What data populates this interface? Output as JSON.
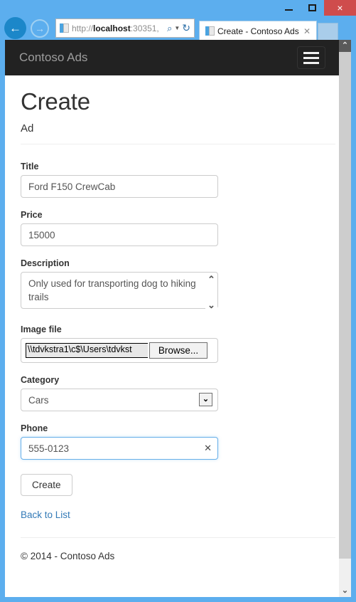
{
  "browser": {
    "window_controls": {
      "minimize": "minimize-icon",
      "maximize": "maximize-icon",
      "close": "×"
    },
    "nav": {
      "back": "←",
      "forward": "→"
    },
    "address": {
      "url_scheme": "http://",
      "url_host": "localhost",
      "url_rest": ":30351,",
      "search_icon": "⌕",
      "caret": "▼",
      "refresh_icon": "↻"
    },
    "tab": {
      "title": "Create - Contoso Ads",
      "close": "✕"
    }
  },
  "site": {
    "brand": "Contoso Ads",
    "menu_toggle": "hamburger-icon"
  },
  "page": {
    "title": "Create",
    "subtitle": "Ad",
    "fields": {
      "title": {
        "label": "Title",
        "value": "Ford F150 CrewCab"
      },
      "price": {
        "label": "Price",
        "value": "15000"
      },
      "description": {
        "label": "Description",
        "value": "Only used for transporting dog to hiking trails"
      },
      "image_file": {
        "label": "Image file",
        "value": "\\\\tdvkstra1\\c$\\Users\\tdvkst",
        "browse_label": "Browse..."
      },
      "category": {
        "label": "Category",
        "value": "Cars",
        "options": [
          "Cars"
        ]
      },
      "phone": {
        "label": "Phone",
        "value": "555-0123",
        "clear_icon": "✕"
      }
    },
    "submit_label": "Create",
    "back_link": "Back to List",
    "footer": "© 2014 - Contoso Ads"
  },
  "scrollbar": {
    "up": "⌃",
    "down": "⌄"
  }
}
